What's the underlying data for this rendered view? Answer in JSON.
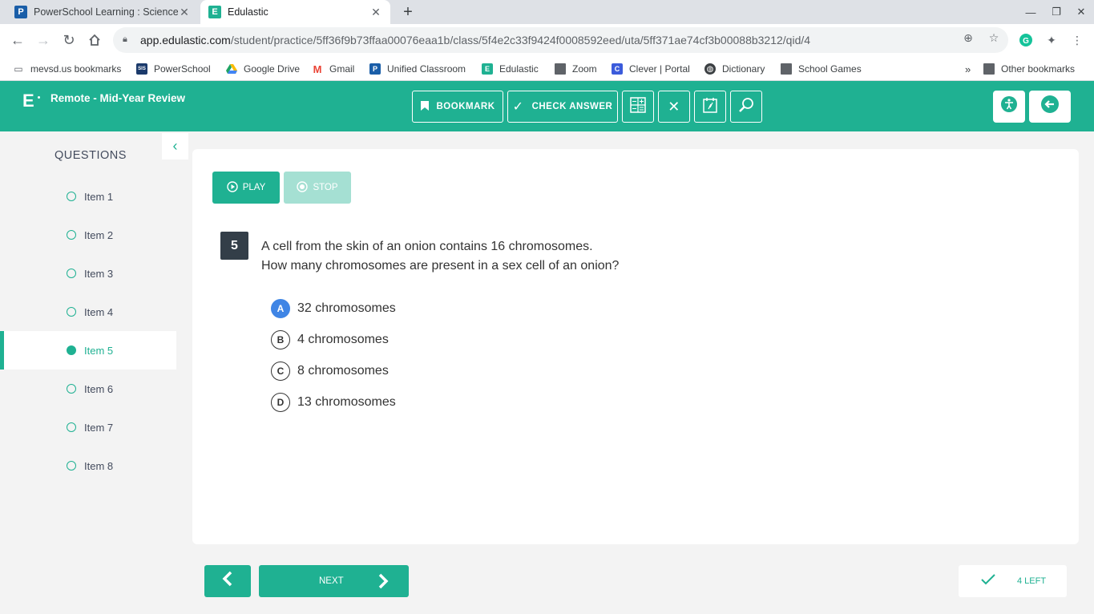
{
  "browser": {
    "tabs": [
      {
        "title": "PowerSchool Learning : Science",
        "favicon": "P",
        "color": "#1a5ea8"
      },
      {
        "title": "Edulastic",
        "favicon": "E",
        "color": "#1fb192"
      }
    ],
    "url_host": "app.edulastic.com",
    "url_path": "/student/practice/5ff36f9b73ffaa00076eaa1b/class/5f4e2c33f9424f0008592eed/uta/5ff371ae74cf3b00088b3212/qid/4",
    "bookmarks": [
      {
        "label": "mevsd.us bookmarks",
        "icon": "folder-icon"
      },
      {
        "label": "PowerSchool",
        "icon": "SIS"
      },
      {
        "label": "Google Drive",
        "icon": "drive-icon"
      },
      {
        "label": "Gmail",
        "icon": "gmail-icon"
      },
      {
        "label": "Unified Classroom",
        "icon": "P"
      },
      {
        "label": "Edulastic",
        "icon": "E"
      },
      {
        "label": "Zoom",
        "icon": "folder-icon"
      },
      {
        "label": "Clever | Portal",
        "icon": "C"
      },
      {
        "label": "Dictionary",
        "icon": "globe-icon"
      },
      {
        "label": "School Games",
        "icon": "folder-icon"
      }
    ],
    "other_bookmarks": "Other bookmarks"
  },
  "header": {
    "logo": "E",
    "assignment_title": "Remote - Mid-Year Review",
    "bookmark_label": "BOOKMARK",
    "check_answer_label": "CHECK ANSWER"
  },
  "sidebar": {
    "title": "QUESTIONS",
    "items": [
      {
        "label": "Item 1"
      },
      {
        "label": "Item 2"
      },
      {
        "label": "Item 3"
      },
      {
        "label": "Item 4"
      },
      {
        "label": "Item 5"
      },
      {
        "label": "Item 6"
      },
      {
        "label": "Item 7"
      },
      {
        "label": "Item 8"
      }
    ],
    "active_index": 4
  },
  "question": {
    "play_label": "PLAY",
    "stop_label": "STOP",
    "number": "5",
    "line1": "A cell from the skin of an onion contains 16 chromosomes.",
    "line2": "How many chromosomes are present in a sex cell of an onion?",
    "choices": [
      {
        "letter": "A",
        "text": "32 chromosomes",
        "selected": true
      },
      {
        "letter": "B",
        "text": "4 chromosomes",
        "selected": false
      },
      {
        "letter": "C",
        "text": "8 chromosomes",
        "selected": false
      },
      {
        "letter": "D",
        "text": "13 chromosomes",
        "selected": false
      }
    ]
  },
  "footer": {
    "next_label": "NEXT",
    "left_label": "4 LEFT"
  },
  "colors": {
    "brand": "#1fb192",
    "selected_choice": "#3f85e5",
    "question_badge": "#333e48"
  }
}
